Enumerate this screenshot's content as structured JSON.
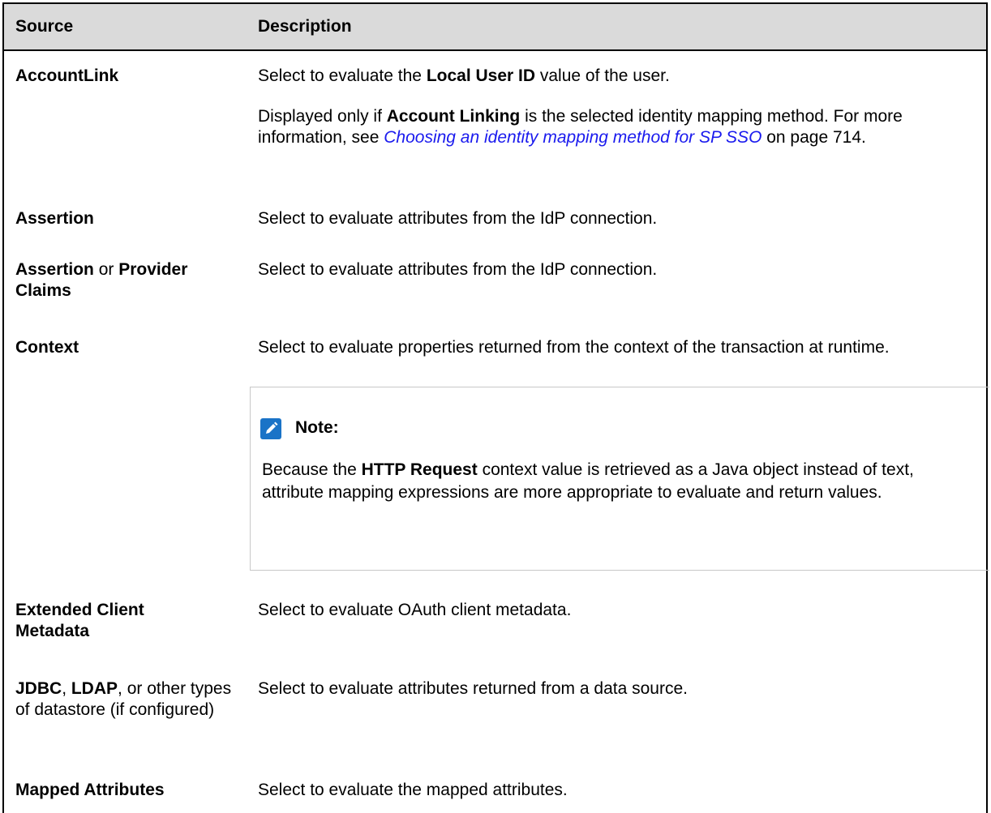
{
  "header": {
    "source": "Source",
    "description": "Description"
  },
  "rows": {
    "accountlink": {
      "source": "AccountLink",
      "d1_a": "Select to evaluate the ",
      "d1_b": "Local User ID",
      "d1_c": " value of the user.",
      "d2_a": "Displayed only if ",
      "d2_b": "Account Linking",
      "d2_c": " is the selected identity mapping method. For more information, see ",
      "d2_link": "Choosing an identity mapping method for SP SSO",
      "d2_d": " on page 714."
    },
    "assertion": {
      "source": "Assertion",
      "desc": "Select to evaluate attributes from the IdP connection."
    },
    "assertion_claims": {
      "s_a": "Assertion",
      "s_b": " or ",
      "s_c": "Provider Claims",
      "desc": "Select to evaluate attributes from the IdP connection."
    },
    "context": {
      "source": "Context",
      "desc": "Select to evaluate properties returned from the context of the transaction at runtime.",
      "note_title": "Note:",
      "note_a": "Because the ",
      "note_b": "HTTP Request",
      "note_c": " context value is retrieved as a Java object instead of text, attribute mapping expressions are more appropriate to evaluate and return values."
    },
    "extended": {
      "source": "Extended Client Metadata",
      "desc": "Select to evaluate OAuth client metadata."
    },
    "jdbc": {
      "s_a": "JDBC",
      "s_b": ", ",
      "s_c": "LDAP",
      "s_d": ", or other types of datastore (if configured)",
      "desc": "Select to evaluate attributes returned from a data source."
    },
    "mapped": {
      "source": "Mapped Attributes",
      "desc": "Select to evaluate the mapped attributes."
    }
  },
  "colors": {
    "header_bg": "#dadada",
    "link": "#1a1aee",
    "note_icon": "#1a73c7"
  },
  "icons": {
    "note": "pencil-note-icon"
  }
}
